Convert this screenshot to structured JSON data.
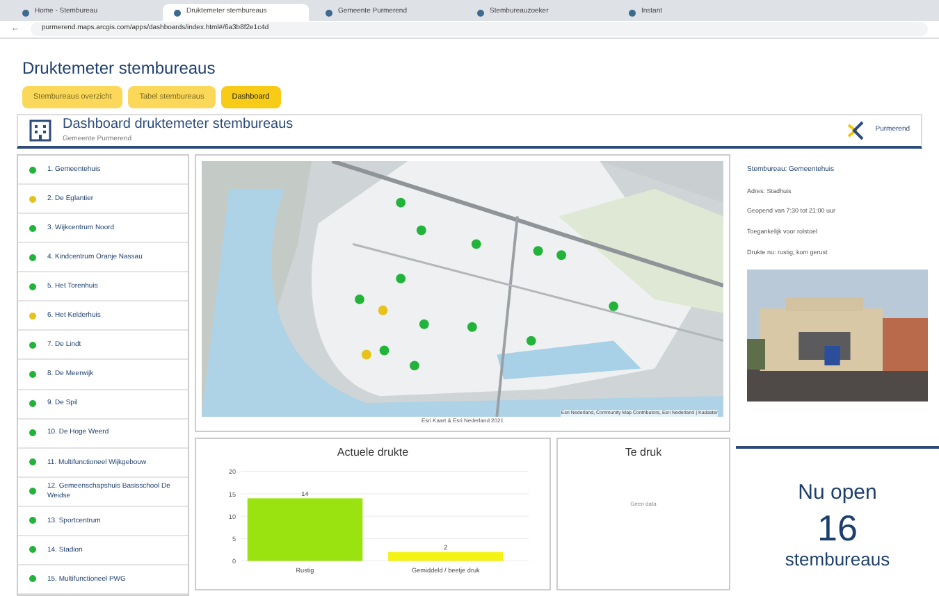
{
  "browser": {
    "tabs": [
      {
        "label": "Home - Stembureau",
        "selected": false
      },
      {
        "label": "Druktemeter stembureaus",
        "selected": true
      },
      {
        "label": "Gemeente Purmerend",
        "selected": false
      },
      {
        "label": "Stembureauzoeker",
        "selected": false
      },
      {
        "label": "Instant",
        "selected": false
      }
    ],
    "back": "←",
    "url": "purmerend.maps.arcgis.com/apps/dashboards/index.html#/6a3b8f2e1c4d"
  },
  "page_title": "Druktemeter stembureaus",
  "nav_buttons": [
    {
      "label": "Stembureaus overzicht",
      "selected": false
    },
    {
      "label": "Tabel stembureaus",
      "selected": false
    },
    {
      "label": "Dashboard",
      "selected": true
    }
  ],
  "header": {
    "title": "Dashboard druktemeter stembureaus",
    "subtitle": "Gemeente Purmerend",
    "logo_text": "Purmerend"
  },
  "stations": [
    {
      "name": "1. Gemeentehuis",
      "color": "#22b33a"
    },
    {
      "name": "2. De Eglantier",
      "color": "#e6c21a"
    },
    {
      "name": "3. Wijkcentrum Noord",
      "color": "#22b33a"
    },
    {
      "name": "4. Kindcentrum Oranje Nassau",
      "color": "#22b33a"
    },
    {
      "name": "5. Het Torenhuis",
      "color": "#22b33a"
    },
    {
      "name": "6. Het Kelderhuis",
      "color": "#e6c21a"
    },
    {
      "name": "7. De Lindt",
      "color": "#22b33a"
    },
    {
      "name": "8. De Meerwijk",
      "color": "#22b33a"
    },
    {
      "name": "9. De Spil",
      "color": "#22b33a"
    },
    {
      "name": "10. De Hoge Weerd",
      "color": "#22b33a"
    },
    {
      "name": "11. Multifunctioneel Wijkgebouw",
      "color": "#22b33a"
    },
    {
      "name": "12. Gemeenschapshuis Basisschool De Weidse",
      "color": "#22b33a"
    },
    {
      "name": "13. Sportcentrum",
      "color": "#22b33a"
    },
    {
      "name": "14. Stadion",
      "color": "#22b33a"
    },
    {
      "name": "15. Multifunctioneel PWG",
      "color": "#22b33a"
    }
  ],
  "map": {
    "attribution": "Esri Nederland, Community Map Contributors, Esri Nederland | Kadaster",
    "caption": "Esri Kaart & Esri Nederland 2021"
  },
  "chart": {
    "title": "Actuele drukte",
    "chart_data": {
      "type": "bar",
      "categories": [
        "Rustig",
        "Gemiddeld / beetje druk"
      ],
      "series": [
        {
          "color": "#9be310",
          "values": [
            14,
            null
          ]
        },
        {
          "color": "#f5f215",
          "values": [
            null,
            2
          ]
        }
      ],
      "stacked": true,
      "grid": true,
      "ylim": [
        0,
        20
      ],
      "yticks": [
        0,
        5,
        10,
        15,
        20
      ],
      "data_labels": true
    }
  },
  "too_busy": {
    "title": "Te druk",
    "empty_text": "Geen data"
  },
  "detail": {
    "title": "Stembureau: Gemeentehuis",
    "lines": [
      "Adres: Stadhuis",
      "Geopend van 7:30 tot 21:00 uur",
      "Toegankelijk voor rolstoel",
      "Drukte nu: rustig, kom gerust"
    ]
  },
  "counter": {
    "top": "Nu open",
    "number": "16",
    "bottom": "stembureaus"
  }
}
